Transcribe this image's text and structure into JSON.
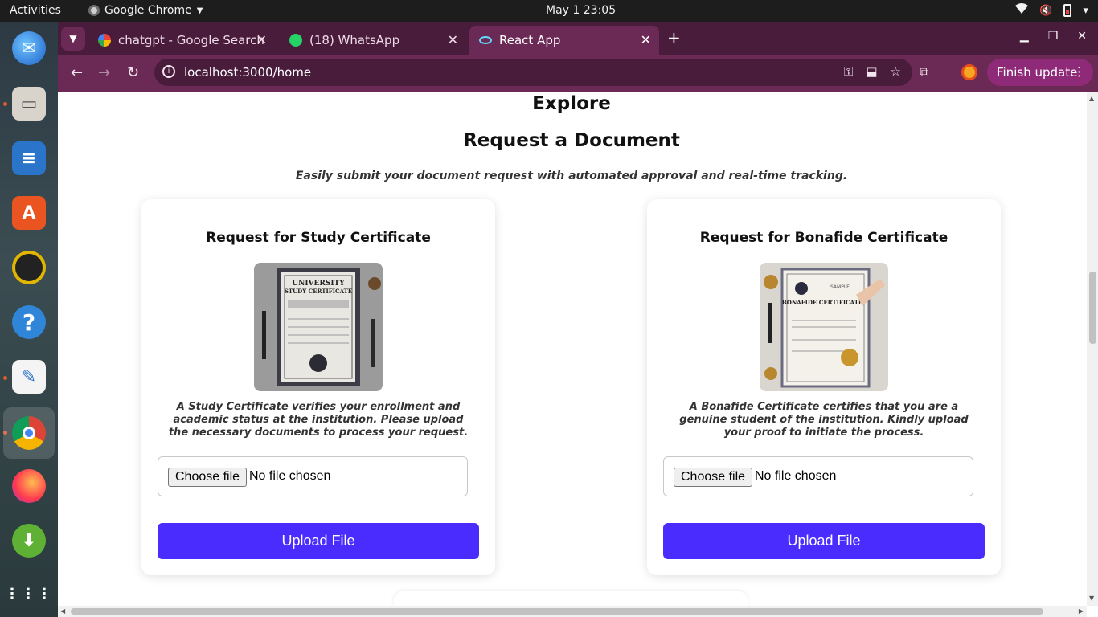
{
  "system_bar": {
    "activities": "Activities",
    "app_name": "Google Chrome",
    "clock": "May 1  23:05"
  },
  "dock": {
    "items": [
      "thunderbird-icon",
      "files-icon",
      "writer-icon",
      "app-center-icon",
      "rhythmbox-icon",
      "help-icon",
      "text-editor-icon",
      "chrome-icon",
      "firefox-icon",
      "installer-icon",
      "show-apps-icon"
    ]
  },
  "browser": {
    "tabs": [
      {
        "label": "chatgpt - Google Search",
        "favicon_color": "#4285f4"
      },
      {
        "label": "(18) WhatsApp",
        "favicon_color": "#25d366"
      },
      {
        "label": "React App",
        "favicon_color": "#61dafb"
      }
    ],
    "url": "localhost:3000/home",
    "finish_update": "Finish update"
  },
  "page": {
    "explore": "Explore",
    "title": "Request a Document",
    "subtitle": "Easily submit your document request with automated approval and real-time tracking.",
    "cards": [
      {
        "heading": "Request for Study Certificate",
        "description": "A Study Certificate verifies your enrollment and academic status at the institution. Please upload the necessary documents to process your request.",
        "choose_label": "Choose file",
        "file_status": "No file chosen",
        "upload_label": "Upload File",
        "image_title": "UNIVERSITY",
        "image_subtitle": "STUDY CERTIFICATE"
      },
      {
        "heading": "Request for Bonafide Certificate",
        "description": "A Bonafide Certificate certifies that you are a genuine student of the institution. Kindly upload your proof to initiate the process.",
        "choose_label": "Choose file",
        "file_status": "No file chosen",
        "upload_label": "Upload File",
        "image_title": "SAMPLE",
        "image_subtitle": "BONAFIDE CERTIFICATE"
      }
    ]
  },
  "colors": {
    "tabstrip": "#4a1c3c",
    "toolbar": "#6b2a55",
    "upload_button": "#4a2cff"
  }
}
